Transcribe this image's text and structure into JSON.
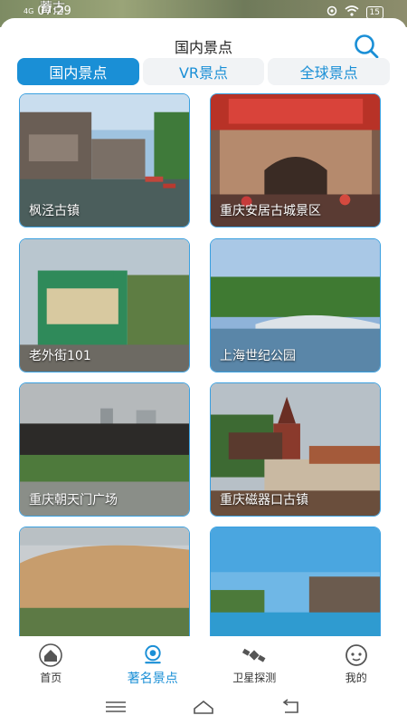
{
  "status_bar": {
    "signal": "4G",
    "time": "07:29",
    "battery": "15",
    "map_label": "蓄古"
  },
  "header": {
    "title": "国内景点"
  },
  "tabs": [
    {
      "label": "国内景点",
      "active": true
    },
    {
      "label": "VR景点",
      "active": false
    },
    {
      "label": "全球景点",
      "active": false
    }
  ],
  "spots": [
    {
      "name": "枫泾古镇"
    },
    {
      "name": "重庆安居古城景区"
    },
    {
      "name": "老外街101"
    },
    {
      "name": "上海世纪公园"
    },
    {
      "name": "重庆朝天门广场"
    },
    {
      "name": "重庆磁器口古镇"
    },
    {
      "name": ""
    },
    {
      "name": ""
    }
  ],
  "bottom_nav": [
    {
      "label": "首页",
      "icon": "home-icon",
      "active": false
    },
    {
      "label": "著名景点",
      "icon": "scenic-spot-icon",
      "active": true
    },
    {
      "label": "卫星探测",
      "icon": "satellite-icon",
      "active": false
    },
    {
      "label": "我的",
      "icon": "profile-icon",
      "active": false
    }
  ],
  "colors": {
    "accent": "#1a8fd6",
    "tab_bg": "#f1f3f5"
  }
}
